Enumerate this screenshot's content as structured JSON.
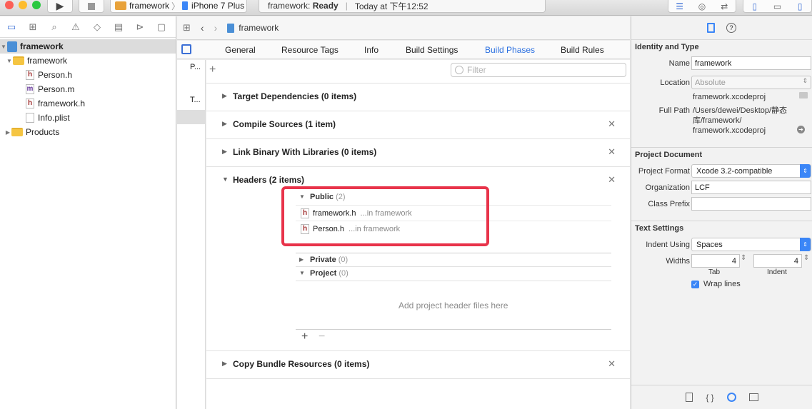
{
  "toolbar": {
    "scheme_target": "framework",
    "scheme_device": "iPhone 7 Plus",
    "status_project": "framework:",
    "status_state": "Ready",
    "status_time": "Today at 下午12:52"
  },
  "navigator": {
    "items": [
      {
        "label": "framework",
        "kind": "project"
      },
      {
        "label": "framework",
        "kind": "folder"
      },
      {
        "label": "Person.h",
        "kind": "h"
      },
      {
        "label": "Person.m",
        "kind": "m"
      },
      {
        "label": "framework.h",
        "kind": "h"
      },
      {
        "label": "Info.plist",
        "kind": "plist"
      },
      {
        "label": "Products",
        "kind": "folder"
      }
    ]
  },
  "editor": {
    "breadcrumb": "framework",
    "tabs": [
      "General",
      "Resource Tags",
      "Info",
      "Build Settings",
      "Build Phases",
      "Build Rules"
    ],
    "active_tab": "Build Phases",
    "targets_truncated": [
      "P...",
      "T..."
    ],
    "filter_placeholder": "Filter",
    "phases": {
      "target_deps": "Target Dependencies (0 items)",
      "compile": "Compile Sources (1 item)",
      "link": "Link Binary With Libraries (0 items)",
      "headers": "Headers (2 items)",
      "copy": "Copy Bundle Resources (0 items)"
    },
    "headers": {
      "public_label": "Public",
      "public_count": "(2)",
      "files": [
        {
          "name": "framework.h",
          "location": "...in framework"
        },
        {
          "name": "Person.h",
          "location": "...in framework"
        }
      ],
      "private_label": "Private",
      "private_count": "(0)",
      "project_label": "Project",
      "project_count": "(0)",
      "empty_hint": "Add project header files here"
    }
  },
  "inspector": {
    "identity_title": "Identity and Type",
    "name_label": "Name",
    "name_value": "framework",
    "location_label": "Location",
    "location_value": "Absolute",
    "location_file": "framework.xcodeproj",
    "fullpath_label": "Full Path",
    "fullpath_line1": "/Users/dewei/Desktop/静态",
    "fullpath_line2": "库/framework/",
    "fullpath_line3": "framework.xcodeproj",
    "project_doc_title": "Project Document",
    "format_label": "Project Format",
    "format_value": "Xcode 3.2-compatible",
    "org_label": "Organization",
    "org_value": "LCF",
    "prefix_label": "Class Prefix",
    "prefix_value": "",
    "text_settings_title": "Text Settings",
    "indent_label": "Indent Using",
    "indent_value": "Spaces",
    "widths_label": "Widths",
    "tab_value": "4",
    "indent_width_value": "4",
    "tab_caption": "Tab",
    "indent_caption": "Indent",
    "wrap_label": "Wrap lines"
  },
  "colors": {
    "accent": "#2a6fe0",
    "highlight_box": "#e8334a",
    "folder": "#f5c542"
  }
}
